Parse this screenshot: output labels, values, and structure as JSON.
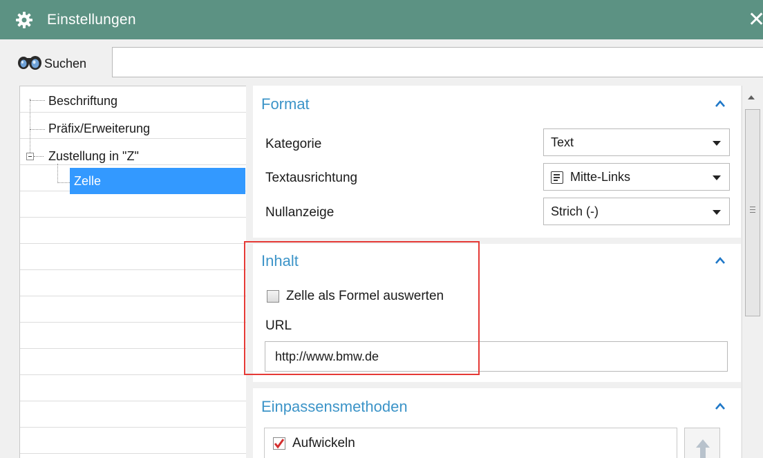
{
  "window": {
    "title": "Einstellungen",
    "close_glyph": "✕",
    "title_icon": "gear-icon",
    "title_bar_color": "#5c9283"
  },
  "search": {
    "label": "Suchen",
    "value": "",
    "icon": "binoculars-icon"
  },
  "tree": {
    "items": [
      {
        "label": "Beschriftung",
        "selected": false
      },
      {
        "label": "Präfix/Erweiterung",
        "selected": false
      },
      {
        "label": "Zustellung in \"Z\"",
        "selected": false,
        "expanded": true
      },
      {
        "label": "Zelle",
        "selected": true
      }
    ],
    "selection_color": "#3399ff"
  },
  "sections": {
    "format": {
      "title": "Format",
      "rows": [
        {
          "label": "Kategorie",
          "value": "Text",
          "icon": ""
        },
        {
          "label": "Textausrichtung",
          "value": "Mitte-Links",
          "icon": "align-left-icon"
        },
        {
          "label": "Nullanzeige",
          "value": "Strich (-)",
          "icon": ""
        }
      ]
    },
    "content": {
      "title": "Inhalt",
      "formula_checkbox_label": "Zelle als Formel auswerten",
      "formula_checked": false,
      "url_label": "URL",
      "url_value": "http://www.bmw.de"
    },
    "fit": {
      "title": "Einpassensmethoden",
      "items": [
        {
          "label": "Aufwickeln",
          "checked": true
        }
      ]
    }
  },
  "colors": {
    "section_title": "#3c94c8",
    "highlight_border": "#e53935",
    "check_mark": "#d32f2f"
  }
}
